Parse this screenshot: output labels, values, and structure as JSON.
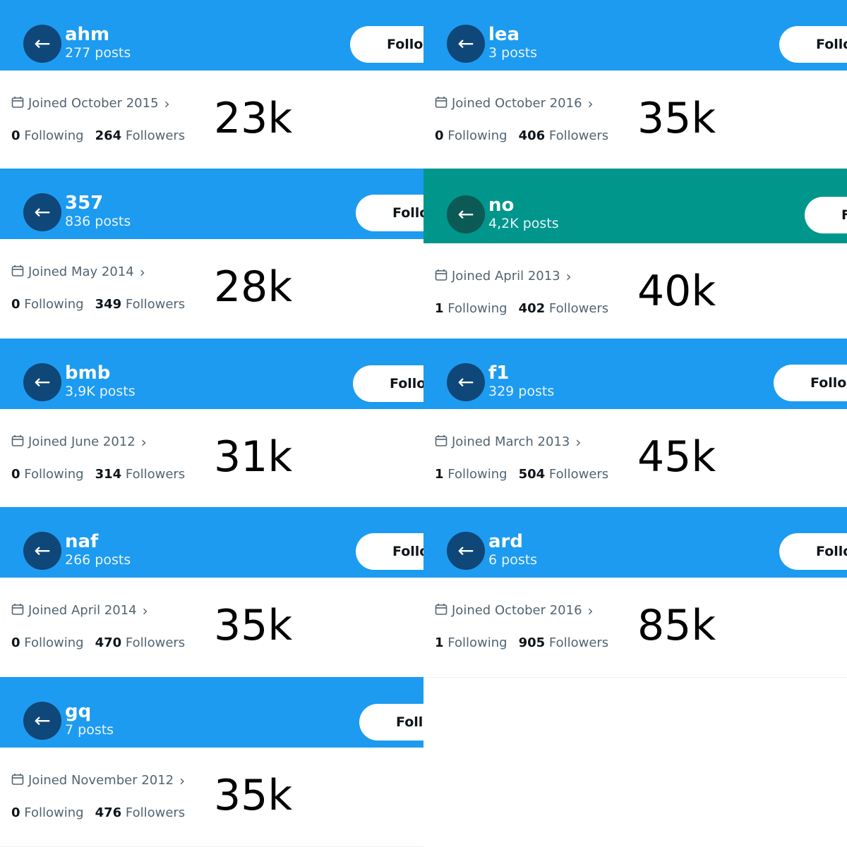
{
  "labels": {
    "follow": "Follow",
    "following": "Following",
    "followers": "Followers"
  },
  "colors": {
    "header_blue": "#1d9bf0",
    "header_teal": "#00968c",
    "back_button_blue": "#0f4778",
    "back_button_teal": "#0b5a55"
  },
  "profiles": [
    {
      "username": "ahm",
      "posts": "277 posts",
      "joined": "Joined October 2015",
      "following": "0",
      "followers": "264",
      "big_number": "23k",
      "header_color": "blue"
    },
    {
      "username": "lea",
      "posts": "3 posts",
      "joined": "Joined October 2016",
      "following": "0",
      "followers": "406",
      "big_number": "35k",
      "header_color": "blue"
    },
    {
      "username": "357",
      "posts": "836 posts",
      "joined": "Joined May 2014",
      "following": "0",
      "followers": "349",
      "big_number": "28k",
      "header_color": "blue"
    },
    {
      "username": "no",
      "posts": "4,2K posts",
      "joined": "Joined April 2013",
      "following": "1",
      "followers": "402",
      "big_number": "40k",
      "header_color": "teal"
    },
    {
      "username": "bmb",
      "posts": "3,9K posts",
      "joined": "Joined June 2012",
      "following": "0",
      "followers": "314",
      "big_number": "31k",
      "header_color": "blue"
    },
    {
      "username": "f1",
      "posts": "329 posts",
      "joined": "Joined March 2013",
      "following": "1",
      "followers": "504",
      "big_number": "45k",
      "header_color": "blue"
    },
    {
      "username": "naf",
      "posts": "266 posts",
      "joined": "Joined April 2014",
      "following": "0",
      "followers": "470",
      "big_number": "35k",
      "header_color": "blue"
    },
    {
      "username": "ard",
      "posts": "6 posts",
      "joined": "Joined October 2016",
      "following": "1",
      "followers": "905",
      "big_number": "85k",
      "header_color": "blue"
    },
    {
      "username": "gq",
      "posts": "7 posts",
      "joined": "Joined November 2012",
      "following": "0",
      "followers": "476",
      "big_number": "35k",
      "header_color": "blue"
    }
  ]
}
